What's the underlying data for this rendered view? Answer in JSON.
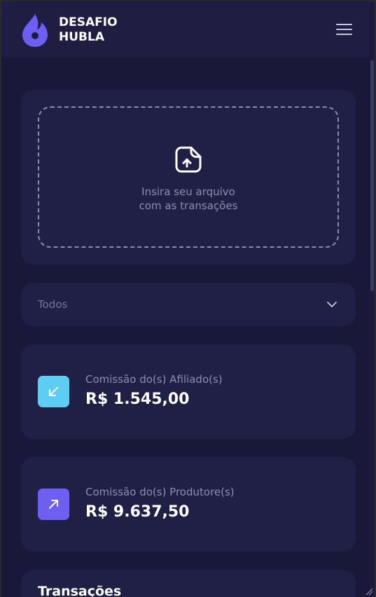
{
  "header": {
    "logo_line1": "DESAFIO",
    "logo_line2": "HUBLA",
    "logo_icon": "flame-logo-icon",
    "menu_icon": "hamburger-menu-icon"
  },
  "upload": {
    "icon": "file-upload-icon",
    "line1": "Insira seu arquivo",
    "line2": "com as transações"
  },
  "filter": {
    "selected": "Todos",
    "icon": "chevron-down-icon"
  },
  "stats": [
    {
      "label": "Comissão do(s) Afiliado(s)",
      "value": "R$ 1.545,00",
      "icon": "arrow-down-left-icon",
      "color": "#5ecdf4"
    },
    {
      "label": "Comissão do(s) Produtore(s)",
      "value": "R$ 9.637,50",
      "icon": "arrow-up-right-icon",
      "color": "#6c5ff2"
    }
  ],
  "transactions": {
    "title": "Transações"
  },
  "colors": {
    "background": "#191838",
    "header": "#1f1e42",
    "card": "#201f45",
    "accent_purple": "#6c5ff2",
    "accent_cyan": "#5ecdf4"
  }
}
